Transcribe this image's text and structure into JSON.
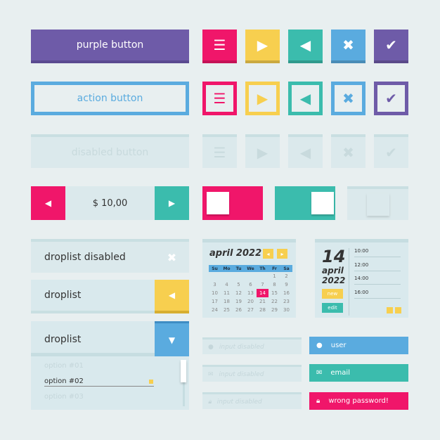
{
  "buttons": {
    "purple": "purple button",
    "action": "action button",
    "disabled": "disabled button"
  },
  "icons": [
    "menu-icon",
    "play-icon",
    "back-icon",
    "close-icon",
    "check-icon"
  ],
  "icon_glyphs": [
    "☰",
    "▶",
    "◀",
    "✖",
    "✔"
  ],
  "colors": [
    "#f0166a",
    "#f7cf4f",
    "#3bbcad",
    "#5aabdf",
    "#6e5ba8"
  ],
  "stepper": {
    "value": "$ 10,00",
    "left": "◀",
    "right": "▶"
  },
  "droplists": {
    "disabled": "droplist disabled",
    "closed": "droplist",
    "open": "droplist",
    "x": "✖",
    "left": "◀",
    "down": "▼"
  },
  "options": [
    "option #01",
    "option #02",
    "option #03"
  ],
  "calendar": {
    "title": "april 2022",
    "prev": "◂",
    "next": "▸",
    "days": [
      "Su",
      "Mo",
      "Tu",
      "We",
      "Th",
      "Fr",
      "Sa"
    ],
    "weeks": [
      [
        "",
        "",
        "",
        "",
        "",
        "1",
        "2"
      ],
      [
        "3",
        "4",
        "5",
        "6",
        "7",
        "8",
        "9"
      ],
      [
        "10",
        "11",
        "12",
        "13",
        "14",
        "15",
        "16"
      ],
      [
        "17",
        "18",
        "19",
        "20",
        "21",
        "22",
        "23"
      ],
      [
        "24",
        "25",
        "26",
        "27",
        "28",
        "29",
        "30"
      ]
    ],
    "selected": "14"
  },
  "schedule": {
    "day": "14",
    "month": "april",
    "year": "2022",
    "new": "new",
    "edit": "edit",
    "times": [
      "10:00",
      "12:00",
      "14:00",
      "16:00"
    ]
  },
  "inputs": {
    "disabled": "input disabled",
    "user": "user",
    "email": "email",
    "password_error": "wrong password!"
  }
}
